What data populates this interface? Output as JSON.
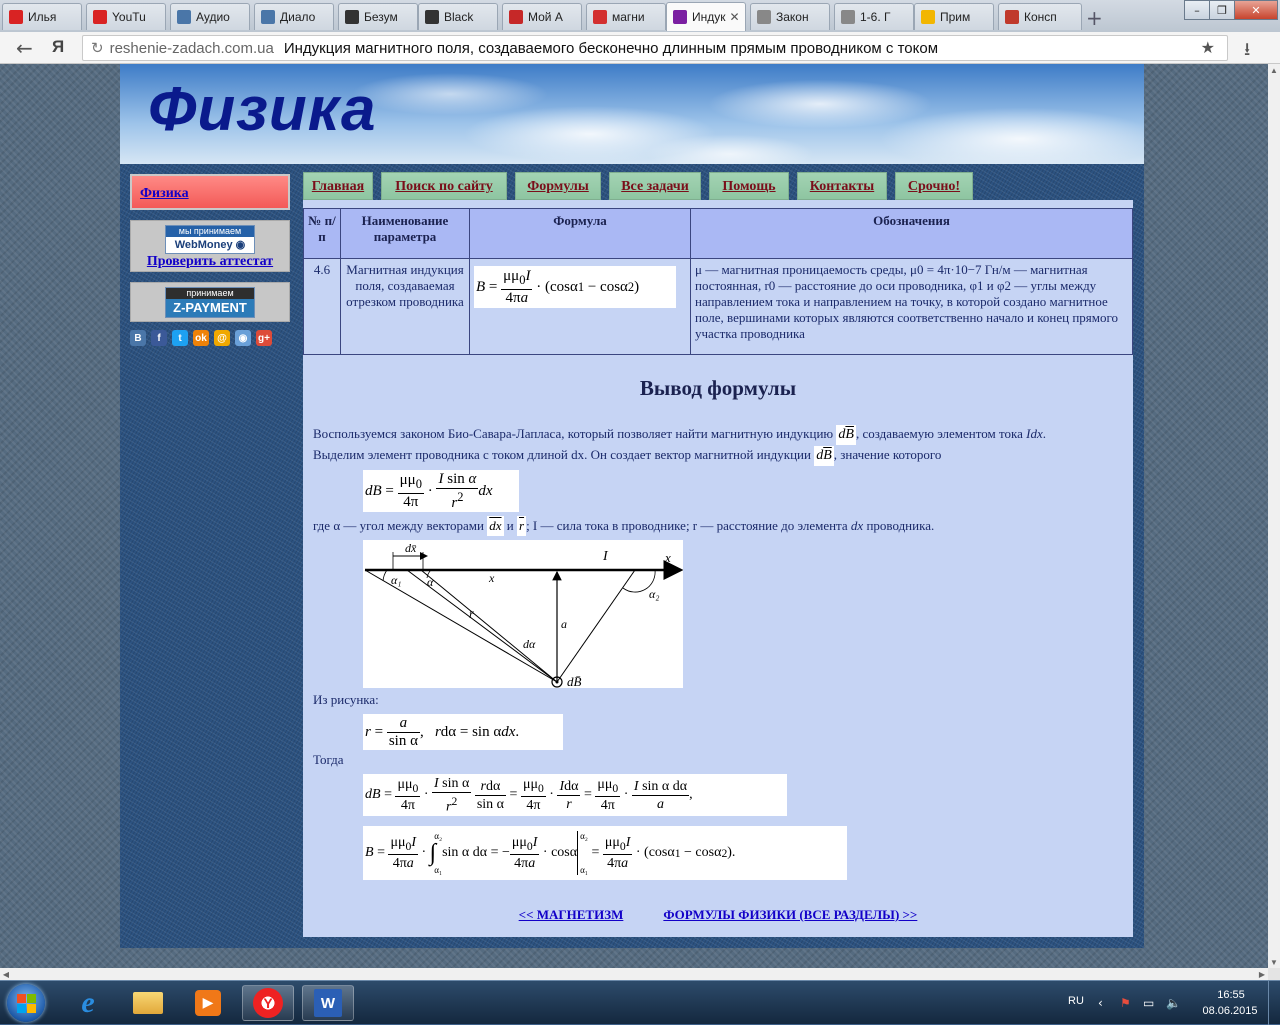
{
  "browser": {
    "tabs": [
      {
        "label": "Илья",
        "icon": "youtube-icon",
        "color": "#d92323"
      },
      {
        "label": "YouTu",
        "icon": "youtube-icon",
        "color": "#d92323"
      },
      {
        "label": "Аудио",
        "icon": "vk-icon",
        "color": "#4a76a8"
      },
      {
        "label": "Диало",
        "icon": "chat-icon",
        "color": "#4a76a8"
      },
      {
        "label": "Безум",
        "icon": "page-icon",
        "color": "#333333"
      },
      {
        "label": "Black",
        "icon": "page-icon",
        "color": "#333333"
      },
      {
        "label": "Мой А",
        "icon": "cart-icon",
        "color": "#c62828"
      },
      {
        "label": "магни",
        "icon": "yandex-icon",
        "color": "#d32f2f"
      },
      {
        "label": "Индук",
        "icon": "phi-icon",
        "color": "#7b1fa2",
        "active": true
      },
      {
        "label": "Закон",
        "icon": "doc-icon",
        "color": "#888888"
      },
      {
        "label": "1-6. Г",
        "icon": "doc-icon",
        "color": "#888888"
      },
      {
        "label": "Прим",
        "icon": "warning-icon",
        "color": "#f2b600"
      },
      {
        "label": "Консп",
        "icon": "pen-icon",
        "color": "#c0392b"
      }
    ],
    "new_tab": "+",
    "win_min": "–",
    "win_max": "❐",
    "win_close": "✕",
    "back": "←",
    "yandex": "Я",
    "reload": "↻",
    "domain": "reshenie-zadach.com.ua",
    "page_title": "Индукция магнитного поля, создаваемого бесконечно длинным прямым проводником с током",
    "star": "★",
    "download": "⭳"
  },
  "site": {
    "logo": "Физика",
    "sidebar": {
      "fizika_link": "Физика",
      "webmoney_top": "мы принимаем",
      "webmoney_main": "WebMoney",
      "webmoney_check": "Проверить аттестат",
      "zpay_top": "принимаем",
      "zpay_main": "Z-PAYMENT",
      "social": [
        {
          "glyph": "В",
          "icon": "vkontakte-icon",
          "color": "#4a76a8"
        },
        {
          "glyph": "f",
          "icon": "facebook-icon",
          "color": "#3b5998"
        },
        {
          "glyph": "t",
          "icon": "twitter-icon",
          "color": "#1da1f2"
        },
        {
          "glyph": "ok",
          "icon": "odnoklassniki-icon",
          "color": "#ee8208"
        },
        {
          "glyph": "@",
          "icon": "mailru-icon",
          "color": "#f0a800"
        },
        {
          "glyph": "◉",
          "icon": "livejournal-icon",
          "color": "#6aa0d8"
        },
        {
          "glyph": "g+",
          "icon": "googleplus-icon",
          "color": "#dd4b39"
        }
      ]
    },
    "nav": [
      "Главная",
      "Поиск по сайту",
      "Формулы",
      "Все задачи",
      "Помощь",
      "Контакты",
      "Срочно!"
    ],
    "table": {
      "headers": [
        "№ п/п",
        "Наименование параметра",
        "Формула",
        "Обозначения"
      ],
      "row": {
        "no": "4.6",
        "name": "Магнитная индукция поля, создаваемая отрезком проводника",
        "formula": "B = μμ₀I / 4πa · (cosα₁ − cosα₂)",
        "desc": "μ — магнитная проницаемость среды, μ0 = 4π·10−7 Гн/м — магнитная постоянная, r0 — расстояние до оси проводника, φ1 и φ2 — углы между направлением тока и направлением на точку, в которой создано магнитное поле, вершинами которых являются соответственно начало и конец прямого участка проводника"
      }
    },
    "derivation": {
      "title": "Вывод формулы",
      "p1a": "Воспользуемся законом Био-Савара-Лапласа, который позволяет найти магнитную индукцию",
      "p1b": ", создаваемую элементом тока",
      "p1c": "Выделим элемент проводника с током длиной dx. Он создает вектор магнитной индукции",
      "p1d": ", значение которого",
      "p2": "где α — угол между векторами",
      "p2b": "и",
      "p2c": "; I — сила тока в проводнике; r — расстояние до элемента",
      "p2d": "проводника.",
      "p3": "Из рисунка:",
      "p4": "Тогда"
    },
    "links": {
      "back": "<< МАГНЕТИЗМ",
      "all": "ФОРМУЛЫ ФИЗИКИ (ВСЕ РАЗДЕЛЫ) >>"
    }
  },
  "taskbar": {
    "lang": "RU",
    "time": "16:55",
    "date": "08.06.2015"
  }
}
